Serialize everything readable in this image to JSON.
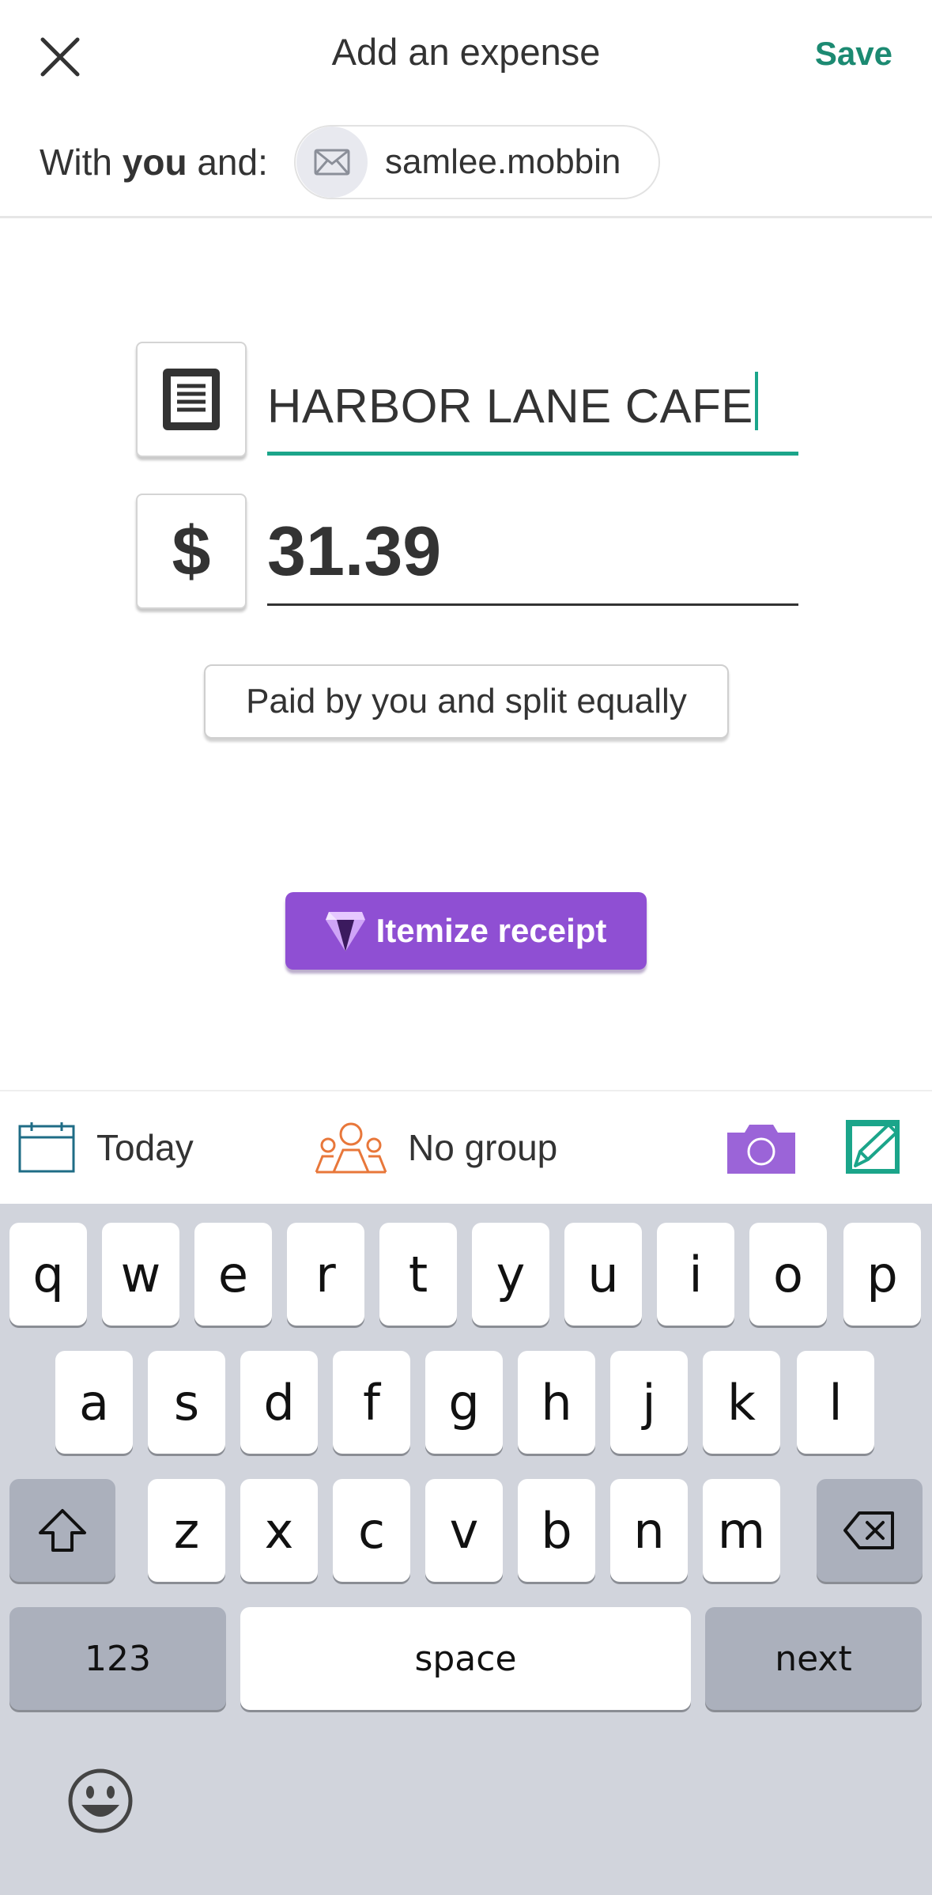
{
  "header": {
    "title": "Add an expense",
    "save_label": "Save",
    "close_icon": "close-icon"
  },
  "with_row": {
    "prefix": "With ",
    "you": "you",
    "suffix": " and:",
    "chip": {
      "icon": "envelope-icon",
      "label": "samlee.mobbin"
    }
  },
  "expense": {
    "description_icon": "receipt-icon",
    "description": "HARBOR LANE CAFE",
    "currency_symbol": "$",
    "amount": "31.39",
    "split_label": "Paid by you and split equally",
    "itemize_label": "Itemize receipt",
    "itemize_icon": "gem-icon"
  },
  "toolbar": {
    "date_label": "Today",
    "date_icon": "calendar-icon",
    "group_label": "No group",
    "group_icon": "group-icon",
    "camera_icon": "camera-icon",
    "note_icon": "edit-note-icon"
  },
  "keyboard": {
    "row1": [
      "q",
      "w",
      "e",
      "r",
      "t",
      "y",
      "u",
      "i",
      "o",
      "p"
    ],
    "row2": [
      "a",
      "s",
      "d",
      "f",
      "g",
      "h",
      "j",
      "k",
      "l"
    ],
    "row3": [
      "z",
      "x",
      "c",
      "v",
      "b",
      "n",
      "m"
    ],
    "numbers_label": "123",
    "space_label": "space",
    "next_label": "next",
    "shift_icon": "shift-icon",
    "backspace_icon": "backspace-icon",
    "emoji_icon": "emoji-icon"
  },
  "colors": {
    "accent": "#1c8a72",
    "underline_active": "#1ba58a",
    "itemize": "#8f4fd3",
    "group_icon": "#e8773a",
    "camera": "#9b64d8",
    "keyboard_bg": "#d1d4dc"
  }
}
